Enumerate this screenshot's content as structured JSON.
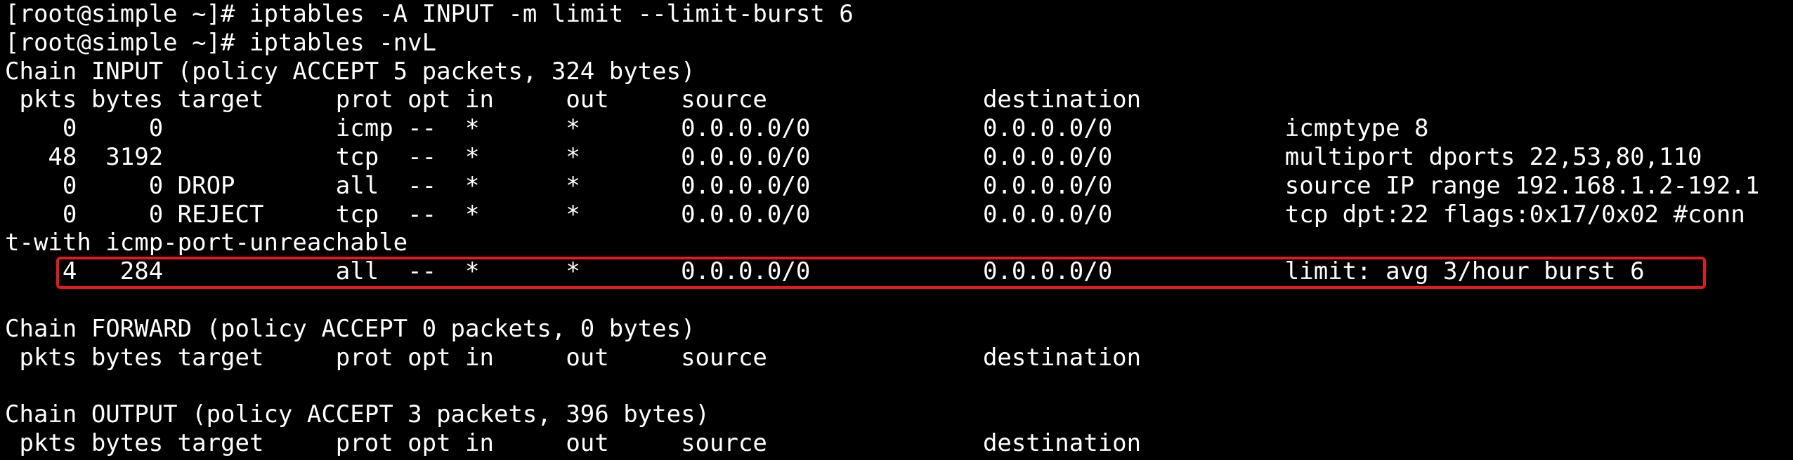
{
  "terminal": {
    "lines": [
      "[root@simple ~]# iptables -A INPUT -m limit --limit-burst 6",
      "[root@simple ~]# iptables -nvL",
      "Chain INPUT (policy ACCEPT 5 packets, 324 bytes)",
      " pkts bytes target     prot opt in     out     source               destination",
      "    0     0            icmp --  *      *       0.0.0.0/0            0.0.0.0/0            icmptype 8",
      "   48  3192            tcp  --  *      *       0.0.0.0/0            0.0.0.0/0            multiport dports 22,53,80,110",
      "    0     0 DROP       all  --  *      *       0.0.0.0/0            0.0.0.0/0            source IP range 192.168.1.2-192.1",
      "    0     0 REJECT     tcp  --  *      *       0.0.0.0/0            0.0.0.0/0            tcp dpt:22 flags:0x17/0x02 #conn",
      "t-with icmp-port-unreachable",
      "    4   284            all  --  *      *       0.0.0.0/0            0.0.0.0/0            limit: avg 3/hour burst 6",
      "",
      "Chain FORWARD (policy ACCEPT 0 packets, 0 bytes)",
      " pkts bytes target     prot opt in     out     source               destination",
      "",
      "Chain OUTPUT (policy ACCEPT 3 packets, 396 bytes)",
      " pkts bytes target     prot opt in     out     source               destination"
    ]
  },
  "colors": {
    "background": "#000000",
    "text": "#ffffff",
    "highlight_border": "#e21c1c"
  }
}
